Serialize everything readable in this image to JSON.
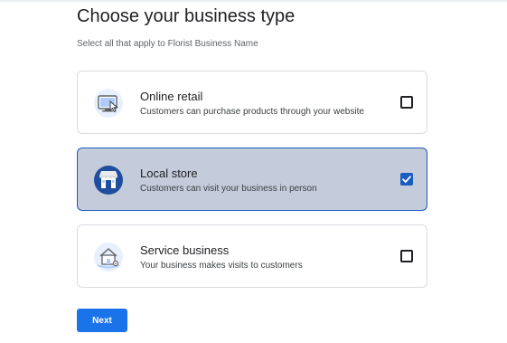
{
  "header": {
    "title": "Choose your business type",
    "subtitle": "Select all that apply to Florist Business Name"
  },
  "options": [
    {
      "title": "Online retail",
      "description": "Customers can purchase products through your website",
      "icon": "online-retail-icon",
      "checked": false
    },
    {
      "title": "Local store",
      "description": "Customers can visit your business in person",
      "icon": "local-store-icon",
      "checked": true
    },
    {
      "title": "Service business",
      "description": "Your business makes visits to customers",
      "icon": "service-business-icon",
      "checked": false
    }
  ],
  "actions": {
    "next_label": "Next"
  },
  "colors": {
    "accent": "#1a73e8",
    "selected_background": "#c4ccdb",
    "selected_border": "#1a5cc0"
  }
}
